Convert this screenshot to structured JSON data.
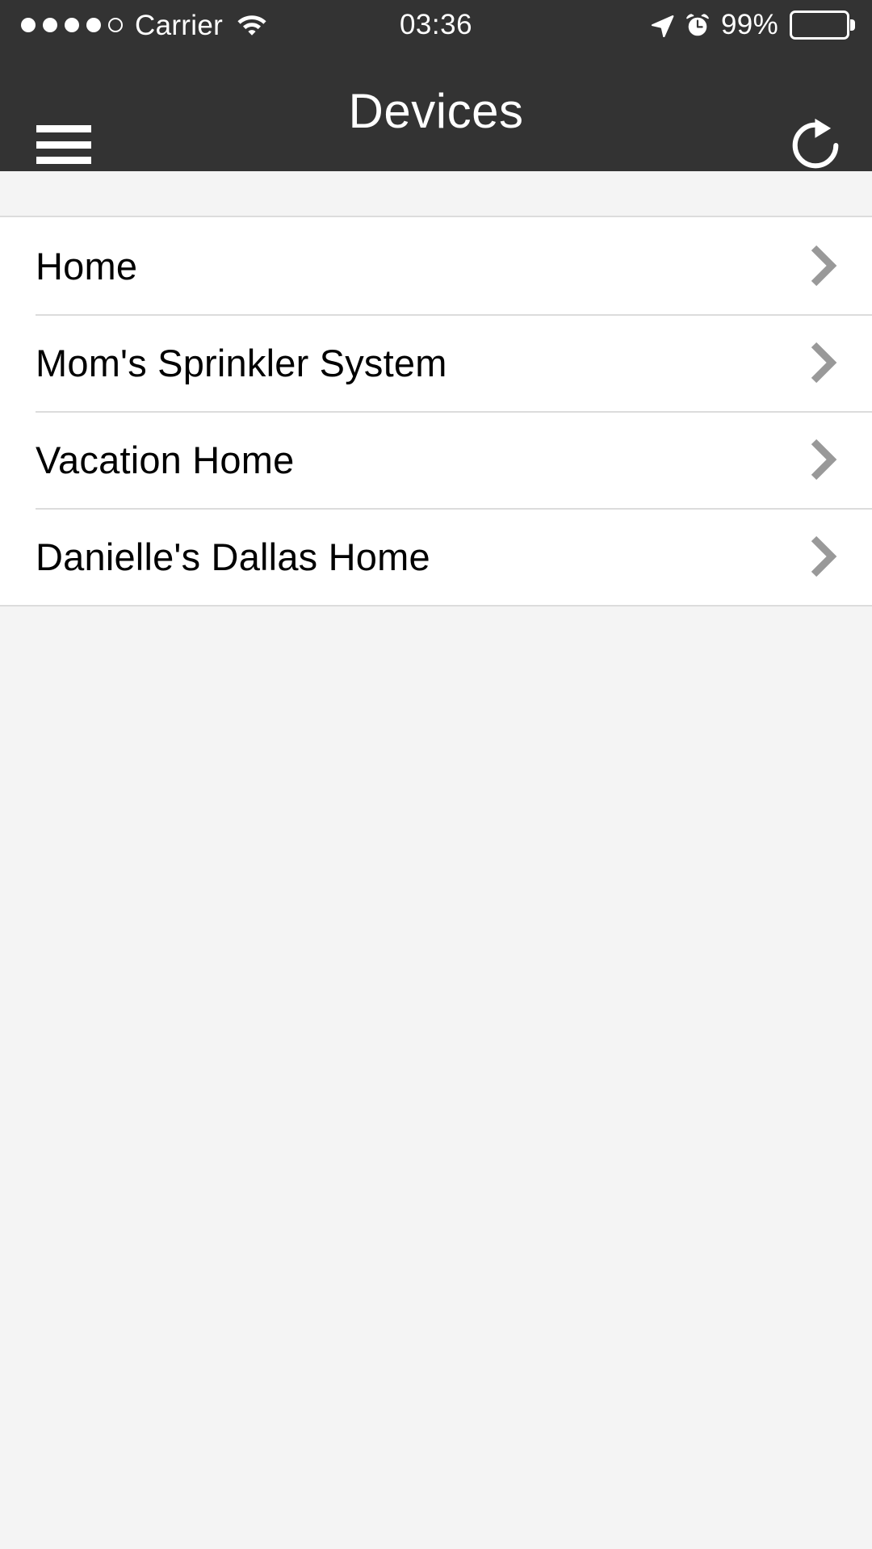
{
  "status_bar": {
    "carrier": "Carrier",
    "signal_dots_filled": 4,
    "signal_dots_total": 5,
    "wifi_icon": "wifi-icon",
    "time": "03:36",
    "location_icon": "location-arrow-icon",
    "alarm_icon": "alarm-clock-icon",
    "battery_percent": "99%",
    "battery_level": 100,
    "battery_color": "#00d6a3",
    "background": "#333333",
    "foreground": "#ffffff"
  },
  "nav_bar": {
    "menu_icon": "hamburger-menu-icon",
    "title": "Devices",
    "refresh_icon": "refresh-icon",
    "background": "#333333",
    "foreground": "#ffffff"
  },
  "list": {
    "chevron_icon": "chevron-right-icon",
    "chevron_color": "#999999",
    "separator_color": "#dcdcdc",
    "row_background": "#ffffff",
    "page_background": "#f4f4f4",
    "items": [
      {
        "label": "Home"
      },
      {
        "label": "Mom's Sprinkler System"
      },
      {
        "label": "Vacation Home"
      },
      {
        "label": "Danielle's Dallas Home"
      }
    ]
  }
}
